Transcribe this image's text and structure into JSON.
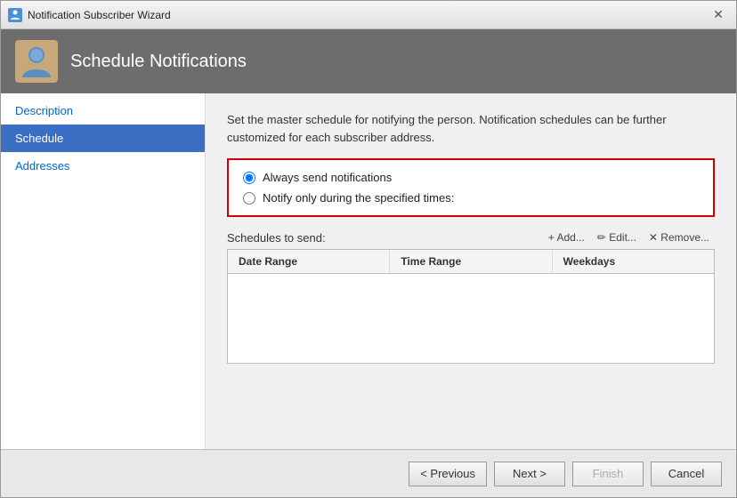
{
  "window": {
    "title": "Notification Subscriber Wizard",
    "close_label": "✕"
  },
  "header": {
    "title": "Schedule Notifications"
  },
  "sidebar": {
    "items": [
      {
        "id": "description",
        "label": "Description",
        "active": false
      },
      {
        "id": "schedule",
        "label": "Schedule",
        "active": true
      },
      {
        "id": "addresses",
        "label": "Addresses",
        "active": false
      }
    ]
  },
  "main": {
    "description": "Set the master schedule for notifying the person. Notification schedules can be further customized for each subscriber address.",
    "radio_options": [
      {
        "id": "always",
        "label": "Always send notifications",
        "checked": true
      },
      {
        "id": "specified",
        "label": "Notify only during the specified times:",
        "checked": false
      }
    ],
    "schedules_label": "Schedules to send:",
    "actions": {
      "add": "+ Add...",
      "edit": "✏ Edit...",
      "remove": "✕ Remove..."
    },
    "table": {
      "columns": [
        "Date Range",
        "Time Range",
        "Weekdays"
      ]
    }
  },
  "footer": {
    "previous_label": "< Previous",
    "next_label": "Next >",
    "finish_label": "Finish",
    "cancel_label": "Cancel"
  }
}
